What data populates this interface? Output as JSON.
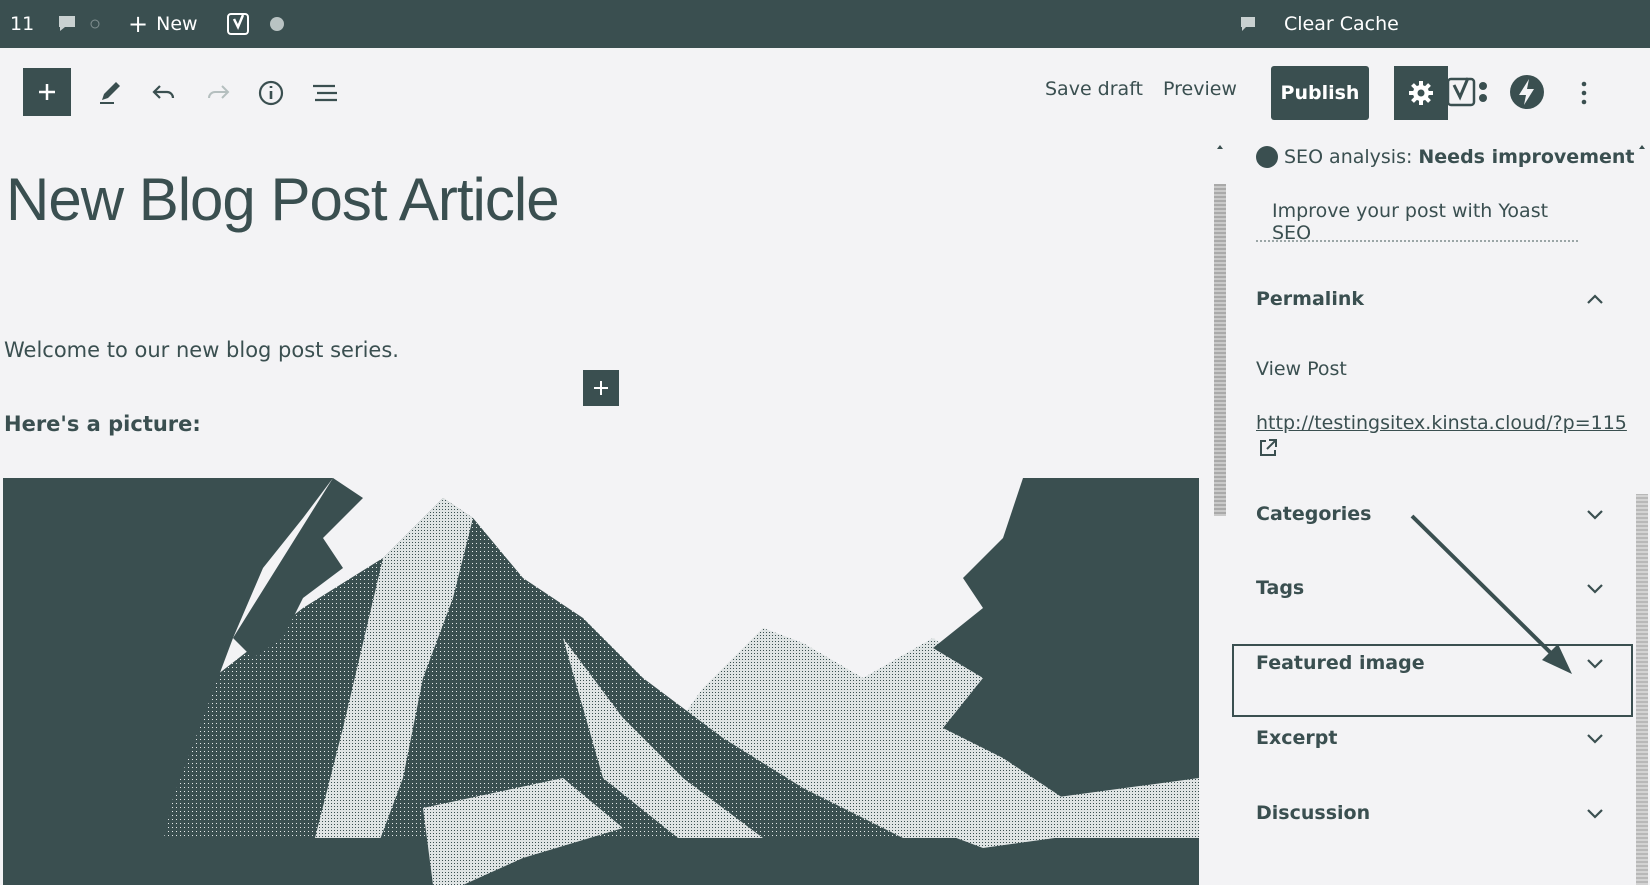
{
  "admin_bar": {
    "count": "11",
    "new_label": "New",
    "clear_cache_label": "Clear Cache"
  },
  "toolbar": {
    "save_draft_label": "Save draft",
    "preview_label": "Preview",
    "publish_label": "Publish"
  },
  "post": {
    "title": "New Blog Post Article",
    "paragraph": "Welcome to our new blog post series.",
    "bold_paragraph": "Here's a picture:"
  },
  "sidebar": {
    "seo_label": "SEO analysis:",
    "seo_status": "Needs improvement",
    "yoast_link": "Improve your post with Yoast SEO",
    "permalink": {
      "title": "Permalink",
      "view_post": "View Post",
      "url": "http://testingsitex.kinsta.cloud/?p=115"
    },
    "panels": [
      "Categories",
      "Tags",
      "Featured image",
      "Excerpt",
      "Discussion"
    ]
  },
  "colors": {
    "primary": "#3a4f50",
    "background": "#f3f3f5"
  }
}
